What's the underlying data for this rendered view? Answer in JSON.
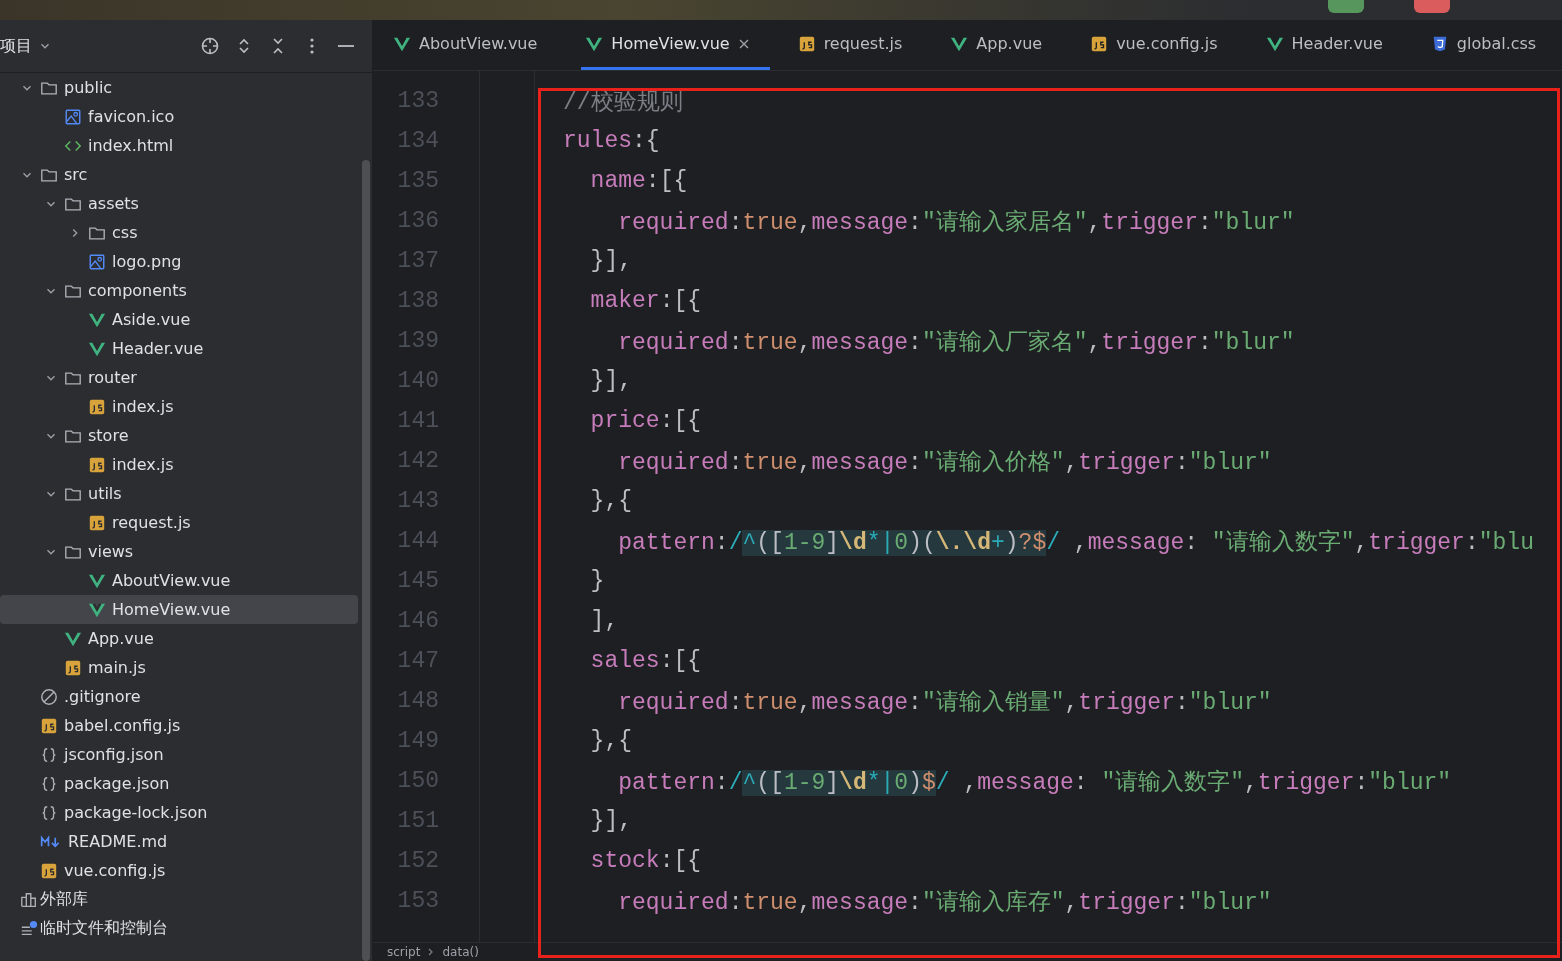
{
  "sidebar": {
    "title": "项目",
    "tree": [
      {
        "label": "public",
        "kind": "folder",
        "expanded": true,
        "selected": false,
        "children": [
          {
            "label": "favicon.ico",
            "kind": "image",
            "selected": false
          },
          {
            "label": "index.html",
            "kind": "html",
            "selected": false
          }
        ]
      },
      {
        "label": "src",
        "kind": "folder",
        "expanded": true,
        "selected": false,
        "children": [
          {
            "label": "assets",
            "kind": "folder",
            "expanded": true,
            "selected": false,
            "children": [
              {
                "label": "css",
                "kind": "folder",
                "expanded": false,
                "selected": false
              },
              {
                "label": "logo.png",
                "kind": "image",
                "selected": false
              }
            ]
          },
          {
            "label": "components",
            "kind": "folder",
            "expanded": true,
            "selected": false,
            "children": [
              {
                "label": "Aside.vue",
                "kind": "vue",
                "selected": false
              },
              {
                "label": "Header.vue",
                "kind": "vue",
                "selected": false
              }
            ]
          },
          {
            "label": "router",
            "kind": "folder",
            "expanded": true,
            "selected": false,
            "children": [
              {
                "label": "index.js",
                "kind": "js",
                "selected": false
              }
            ]
          },
          {
            "label": "store",
            "kind": "folder",
            "expanded": true,
            "selected": false,
            "children": [
              {
                "label": "index.js",
                "kind": "js",
                "selected": false
              }
            ]
          },
          {
            "label": "utils",
            "kind": "folder",
            "expanded": true,
            "selected": false,
            "children": [
              {
                "label": "request.js",
                "kind": "js",
                "selected": false
              }
            ]
          },
          {
            "label": "views",
            "kind": "folder",
            "expanded": true,
            "selected": false,
            "children": [
              {
                "label": "AboutView.vue",
                "kind": "vue",
                "selected": false
              },
              {
                "label": "HomeView.vue",
                "kind": "vue",
                "selected": true
              }
            ]
          },
          {
            "label": "App.vue",
            "kind": "vue",
            "selected": false
          },
          {
            "label": "main.js",
            "kind": "js",
            "selected": false
          }
        ]
      },
      {
        "label": ".gitignore",
        "kind": "ignore",
        "selected": false
      },
      {
        "label": "babel.config.js",
        "kind": "js",
        "selected": false
      },
      {
        "label": "jsconfig.json",
        "kind": "json",
        "selected": false
      },
      {
        "label": "package.json",
        "kind": "json",
        "selected": false
      },
      {
        "label": "package-lock.json",
        "kind": "json",
        "selected": false
      },
      {
        "label": "README.md",
        "kind": "md",
        "selected": false
      },
      {
        "label": "vue.config.js",
        "kind": "js",
        "selected": false
      }
    ],
    "extra": [
      {
        "label": "外部库",
        "kind": "library"
      },
      {
        "label": "临时文件和控制台",
        "kind": "scratch"
      }
    ]
  },
  "tabs": [
    {
      "label": "AboutView.vue",
      "kind": "vue",
      "selected": false
    },
    {
      "label": "HomeView.vue",
      "kind": "vue",
      "selected": true
    },
    {
      "label": "request.js",
      "kind": "js",
      "selected": false
    },
    {
      "label": "App.vue",
      "kind": "vue",
      "selected": false
    },
    {
      "label": "vue.config.js",
      "kind": "js",
      "selected": false
    },
    {
      "label": "Header.vue",
      "kind": "vue",
      "selected": false
    },
    {
      "label": "global.css",
      "kind": "css",
      "selected": false
    }
  ],
  "code": [
    {
      "number": "133",
      "tokens": [
        {
          "kind": "comment",
          "text": "//校验规则"
        }
      ]
    },
    {
      "number": "134",
      "tokens": [
        {
          "kind": "prop",
          "text": "rules"
        },
        {
          "kind": "punct",
          "text": ":{"
        }
      ]
    },
    {
      "number": "135",
      "tokens": [
        {
          "kind": "prop",
          "text": "  name"
        },
        {
          "kind": "punct",
          "text": ":[{"
        }
      ]
    },
    {
      "number": "136",
      "tokens": [
        {
          "kind": "prop",
          "text": "    required"
        },
        {
          "kind": "punct",
          "text": ":"
        },
        {
          "kind": "bool",
          "text": "true"
        },
        {
          "kind": "punct",
          "text": ","
        },
        {
          "kind": "prop",
          "text": "message"
        },
        {
          "kind": "punct",
          "text": ":"
        },
        {
          "kind": "str",
          "text": "\"请输入家居名\""
        },
        {
          "kind": "punct",
          "text": ","
        },
        {
          "kind": "prop",
          "text": "trigger"
        },
        {
          "kind": "punct",
          "text": ":"
        },
        {
          "kind": "str",
          "text": "\"blur\""
        }
      ]
    },
    {
      "number": "137",
      "tokens": [
        {
          "kind": "punct",
          "text": "  }],"
        }
      ]
    },
    {
      "number": "138",
      "tokens": [
        {
          "kind": "prop",
          "text": "  maker"
        },
        {
          "kind": "punct",
          "text": ":[{"
        }
      ]
    },
    {
      "number": "139",
      "tokens": [
        {
          "kind": "prop",
          "text": "    required"
        },
        {
          "kind": "punct",
          "text": ":"
        },
        {
          "kind": "bool",
          "text": "true"
        },
        {
          "kind": "punct",
          "text": ","
        },
        {
          "kind": "prop",
          "text": "message"
        },
        {
          "kind": "punct",
          "text": ":"
        },
        {
          "kind": "str",
          "text": "\"请输入厂家名\""
        },
        {
          "kind": "punct",
          "text": ","
        },
        {
          "kind": "prop",
          "text": "trigger"
        },
        {
          "kind": "punct",
          "text": ":"
        },
        {
          "kind": "str",
          "text": "\"blur\""
        }
      ]
    },
    {
      "number": "140",
      "tokens": [
        {
          "kind": "punct",
          "text": "  }],"
        }
      ]
    },
    {
      "number": "141",
      "tokens": [
        {
          "kind": "prop",
          "text": "  price"
        },
        {
          "kind": "punct",
          "text": ":[{"
        }
      ]
    },
    {
      "number": "142",
      "tokens": [
        {
          "kind": "prop",
          "text": "    required"
        },
        {
          "kind": "punct",
          "text": ":"
        },
        {
          "kind": "bool",
          "text": "true"
        },
        {
          "kind": "punct",
          "text": ","
        },
        {
          "kind": "prop",
          "text": "message"
        },
        {
          "kind": "punct",
          "text": ":"
        },
        {
          "kind": "str",
          "text": "\"请输入价格\""
        },
        {
          "kind": "punct",
          "text": ","
        },
        {
          "kind": "prop",
          "text": "trigger"
        },
        {
          "kind": "punct",
          "text": ":"
        },
        {
          "kind": "str",
          "text": "\"blur\""
        }
      ]
    },
    {
      "number": "143",
      "tokens": [
        {
          "kind": "punct",
          "text": "  },{"
        }
      ]
    },
    {
      "number": "144",
      "tokens": [
        {
          "kind": "prop",
          "text": "    pattern"
        },
        {
          "kind": "punct",
          "text": ":"
        },
        {
          "kind": "re-delim",
          "text": "/"
        },
        {
          "kind": "re-op",
          "text": "^"
        },
        {
          "kind": "re-grp",
          "text": "(["
        },
        {
          "kind": "re-text",
          "text": "1-9"
        },
        {
          "kind": "re-grp",
          "text": "]"
        },
        {
          "kind": "re-esc",
          "text": "\\d"
        },
        {
          "kind": "re-op",
          "text": "*|"
        },
        {
          "kind": "re-text",
          "text": "0"
        },
        {
          "kind": "re-grp",
          "text": ")("
        },
        {
          "kind": "re-esc",
          "text": "\\."
        },
        {
          "kind": "re-esc",
          "text": "\\d"
        },
        {
          "kind": "re-op",
          "text": "+"
        },
        {
          "kind": "re-grp",
          "text": ")"
        },
        {
          "kind": "re-anchor",
          "text": "?$"
        },
        {
          "kind": "re-delim",
          "text": "/"
        },
        {
          "kind": "punct",
          "text": " ,"
        },
        {
          "kind": "prop",
          "text": "message"
        },
        {
          "kind": "punct",
          "text": ": "
        },
        {
          "kind": "str",
          "text": "\"请输入数字\""
        },
        {
          "kind": "punct",
          "text": ","
        },
        {
          "kind": "prop",
          "text": "trigger"
        },
        {
          "kind": "punct",
          "text": ":"
        },
        {
          "kind": "str",
          "text": "\"blu"
        }
      ]
    },
    {
      "number": "145",
      "tokens": [
        {
          "kind": "punct",
          "text": "  }"
        }
      ]
    },
    {
      "number": "146",
      "tokens": [
        {
          "kind": "punct",
          "text": "  ],"
        }
      ]
    },
    {
      "number": "147",
      "tokens": [
        {
          "kind": "prop",
          "text": "  sales"
        },
        {
          "kind": "punct",
          "text": ":[{"
        }
      ]
    },
    {
      "number": "148",
      "tokens": [
        {
          "kind": "prop",
          "text": "    required"
        },
        {
          "kind": "punct",
          "text": ":"
        },
        {
          "kind": "bool",
          "text": "true"
        },
        {
          "kind": "punct",
          "text": ","
        },
        {
          "kind": "prop",
          "text": "message"
        },
        {
          "kind": "punct",
          "text": ":"
        },
        {
          "kind": "str",
          "text": "\"请输入销量\""
        },
        {
          "kind": "punct",
          "text": ","
        },
        {
          "kind": "prop",
          "text": "trigger"
        },
        {
          "kind": "punct",
          "text": ":"
        },
        {
          "kind": "str",
          "text": "\"blur\""
        }
      ]
    },
    {
      "number": "149",
      "tokens": [
        {
          "kind": "punct",
          "text": "  },{"
        }
      ]
    },
    {
      "number": "150",
      "tokens": [
        {
          "kind": "prop",
          "text": "    pattern"
        },
        {
          "kind": "punct",
          "text": ":"
        },
        {
          "kind": "re-delim",
          "text": "/"
        },
        {
          "kind": "re-op",
          "text": "^"
        },
        {
          "kind": "re-grp",
          "text": "(["
        },
        {
          "kind": "re-text",
          "text": "1-9"
        },
        {
          "kind": "re-grp",
          "text": "]"
        },
        {
          "kind": "re-esc",
          "text": "\\d"
        },
        {
          "kind": "re-op",
          "text": "*|"
        },
        {
          "kind": "re-text",
          "text": "0"
        },
        {
          "kind": "re-grp",
          "text": ")"
        },
        {
          "kind": "re-anchor",
          "text": "$"
        },
        {
          "kind": "re-delim",
          "text": "/"
        },
        {
          "kind": "punct",
          "text": " ,"
        },
        {
          "kind": "prop",
          "text": "message"
        },
        {
          "kind": "punct",
          "text": ": "
        },
        {
          "kind": "str",
          "text": "\"请输入数字\""
        },
        {
          "kind": "punct",
          "text": ","
        },
        {
          "kind": "prop",
          "text": "trigger"
        },
        {
          "kind": "punct",
          "text": ":"
        },
        {
          "kind": "str",
          "text": "\"blur\""
        }
      ]
    },
    {
      "number": "151",
      "tokens": [
        {
          "kind": "punct",
          "text": "  }],"
        }
      ]
    },
    {
      "number": "152",
      "tokens": [
        {
          "kind": "prop",
          "text": "  stock"
        },
        {
          "kind": "punct",
          "text": ":[{"
        }
      ]
    },
    {
      "number": "153",
      "tokens": [
        {
          "kind": "prop",
          "text": "    required"
        },
        {
          "kind": "punct",
          "text": ":"
        },
        {
          "kind": "bool",
          "text": "true"
        },
        {
          "kind": "punct",
          "text": ","
        },
        {
          "kind": "prop",
          "text": "message"
        },
        {
          "kind": "punct",
          "text": ":"
        },
        {
          "kind": "str",
          "text": "\"请输入库存\""
        },
        {
          "kind": "punct",
          "text": ","
        },
        {
          "kind": "prop",
          "text": "trigger"
        },
        {
          "kind": "punct",
          "text": ":"
        },
        {
          "kind": "str",
          "text": "\"blur\""
        }
      ]
    }
  ],
  "breadcrumbs": [
    "script",
    "data()"
  ]
}
